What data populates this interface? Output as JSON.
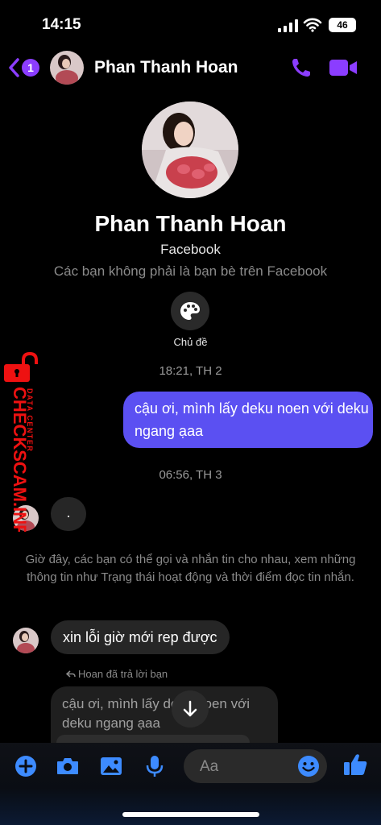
{
  "status_bar": {
    "time": "14:15",
    "battery": "46"
  },
  "header": {
    "back_badge": "1",
    "contact_name": "Phan Thanh Hoan",
    "accent_color": "#8b3dff"
  },
  "profile": {
    "name": "Phan Thanh Hoan",
    "source": "Facebook",
    "note": "Các bạn không phải là bạn bè trên Facebook",
    "theme_label": "Chủ đề"
  },
  "messages": {
    "timestamp_1": "18:21, TH 2",
    "outgoing_1": "cậu ơi, mình lấy deku noen với deku ngang ạaa",
    "timestamp_2": "06:56, TH 3",
    "incoming_dot": ".",
    "system_note": "Giờ đây, các bạn có thể gọi và nhắn tin cho nhau, xem những thông tin như Trạng thái hoạt động và thời điểm đọc tin nhắn.",
    "incoming_2": "xin lỗi giờ mới rep được",
    "reply_label": "Hoan đã trả lời bạn",
    "reply_quote": "cậu ơi, mình lấy deku noen với deku ngang ạaa",
    "outgoing_color": "#5b50f2"
  },
  "composer": {
    "placeholder": "Aa"
  },
  "watermark": {
    "main": "CHECKSCAM.INFO",
    "sub": "DATA CENTER"
  }
}
